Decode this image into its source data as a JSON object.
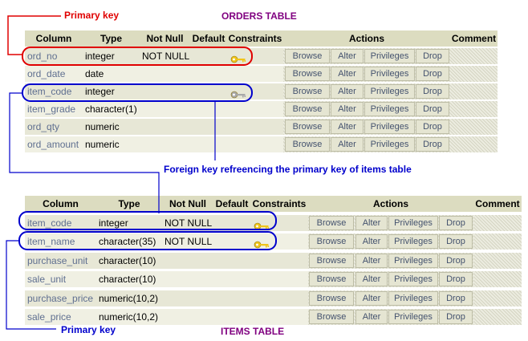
{
  "annotations": {
    "primary_key_top": "Primary key",
    "orders_table": "ORDERS TABLE",
    "foreign_key": "Foreign key refreencing the primary key of items table",
    "primary_key_bottom": "Primary key",
    "items_table": "ITEMS TABLE"
  },
  "headers": {
    "column": "Column",
    "type": "Type",
    "not_null": "Not Null",
    "default": "Default",
    "constraints": "Constraints",
    "actions": "Actions",
    "comment": "Comment"
  },
  "buttons": {
    "browse": "Browse",
    "alter": "Alter",
    "privileges": "Privileges",
    "drop": "Drop"
  },
  "orders": {
    "rows": [
      {
        "column": "ord_no",
        "type": "integer",
        "not_null": "NOT NULL",
        "key": "primary"
      },
      {
        "column": "ord_date",
        "type": "date",
        "not_null": "",
        "key": ""
      },
      {
        "column": "item_code",
        "type": "integer",
        "not_null": "",
        "key": "foreign"
      },
      {
        "column": "item_grade",
        "type": "character(1)",
        "not_null": "",
        "key": ""
      },
      {
        "column": "ord_qty",
        "type": "numeric",
        "not_null": "",
        "key": ""
      },
      {
        "column": "ord_amount",
        "type": "numeric",
        "not_null": "",
        "key": ""
      }
    ]
  },
  "items": {
    "rows": [
      {
        "column": "item_code",
        "type": "integer",
        "not_null": "NOT NULL",
        "key": "primary"
      },
      {
        "column": "item_name",
        "type": "character(35)",
        "not_null": "NOT NULL",
        "key": "primary"
      },
      {
        "column": "purchase_unit",
        "type": "character(10)",
        "not_null": "",
        "key": ""
      },
      {
        "column": "sale_unit",
        "type": "character(10)",
        "not_null": "",
        "key": ""
      },
      {
        "column": "purchase_price",
        "type": "numeric(10,2)",
        "not_null": "",
        "key": ""
      },
      {
        "column": "sale_price",
        "type": "numeric(10,2)",
        "not_null": "",
        "key": ""
      }
    ]
  },
  "colors": {
    "annotation_red": "#e00000",
    "annotation_blue": "#0000cc",
    "table_title_purple": "#800080",
    "header_bg": "#dcdcc0",
    "key_gold": "#f0c419",
    "key_gray": "#a8a8a8"
  }
}
